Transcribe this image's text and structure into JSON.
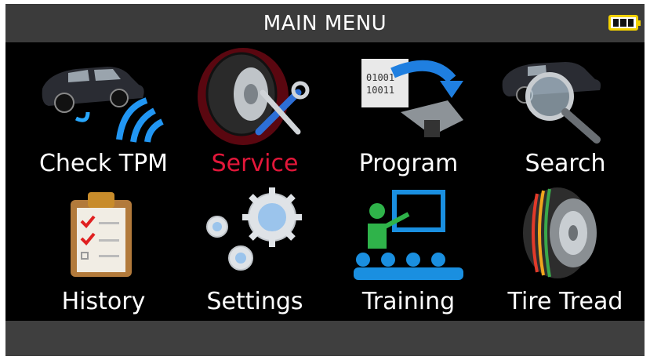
{
  "header": {
    "title": "MAIN MENU",
    "battery_icon": "battery-full-icon"
  },
  "menu": {
    "items": [
      {
        "label": "Check  TPM",
        "icon": "car-sensor-signal-icon",
        "selected": false
      },
      {
        "label": "Service",
        "icon": "tire-tools-icon",
        "selected": true
      },
      {
        "label": "Program",
        "icon": "program-sensor-icon",
        "selected": false
      },
      {
        "label": "Search",
        "icon": "car-magnifier-icon",
        "selected": false
      },
      {
        "label": "History",
        "icon": "clipboard-checklist-icon",
        "selected": false
      },
      {
        "label": "Settings",
        "icon": "gears-icon",
        "selected": false
      },
      {
        "label": "Training",
        "icon": "training-presentation-icon",
        "selected": false
      },
      {
        "label": "Tire Tread",
        "icon": "tire-tread-icon",
        "selected": false
      }
    ]
  },
  "colors": {
    "title_bar": "#3b3b3b",
    "selected_label": "#e3173a",
    "battery": "#f2d100"
  }
}
